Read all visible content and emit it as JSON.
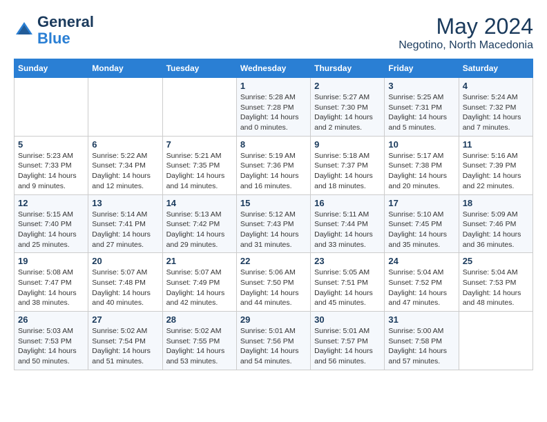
{
  "header": {
    "logo_line1": "General",
    "logo_line2": "Blue",
    "month": "May 2024",
    "location": "Negotino, North Macedonia"
  },
  "weekdays": [
    "Sunday",
    "Monday",
    "Tuesday",
    "Wednesday",
    "Thursday",
    "Friday",
    "Saturday"
  ],
  "weeks": [
    [
      {
        "day": "",
        "info": ""
      },
      {
        "day": "",
        "info": ""
      },
      {
        "day": "",
        "info": ""
      },
      {
        "day": "1",
        "info": "Sunrise: 5:28 AM\nSunset: 7:28 PM\nDaylight: 14 hours\nand 0 minutes."
      },
      {
        "day": "2",
        "info": "Sunrise: 5:27 AM\nSunset: 7:30 PM\nDaylight: 14 hours\nand 2 minutes."
      },
      {
        "day": "3",
        "info": "Sunrise: 5:25 AM\nSunset: 7:31 PM\nDaylight: 14 hours\nand 5 minutes."
      },
      {
        "day": "4",
        "info": "Sunrise: 5:24 AM\nSunset: 7:32 PM\nDaylight: 14 hours\nand 7 minutes."
      }
    ],
    [
      {
        "day": "5",
        "info": "Sunrise: 5:23 AM\nSunset: 7:33 PM\nDaylight: 14 hours\nand 9 minutes."
      },
      {
        "day": "6",
        "info": "Sunrise: 5:22 AM\nSunset: 7:34 PM\nDaylight: 14 hours\nand 12 minutes."
      },
      {
        "day": "7",
        "info": "Sunrise: 5:21 AM\nSunset: 7:35 PM\nDaylight: 14 hours\nand 14 minutes."
      },
      {
        "day": "8",
        "info": "Sunrise: 5:19 AM\nSunset: 7:36 PM\nDaylight: 14 hours\nand 16 minutes."
      },
      {
        "day": "9",
        "info": "Sunrise: 5:18 AM\nSunset: 7:37 PM\nDaylight: 14 hours\nand 18 minutes."
      },
      {
        "day": "10",
        "info": "Sunrise: 5:17 AM\nSunset: 7:38 PM\nDaylight: 14 hours\nand 20 minutes."
      },
      {
        "day": "11",
        "info": "Sunrise: 5:16 AM\nSunset: 7:39 PM\nDaylight: 14 hours\nand 22 minutes."
      }
    ],
    [
      {
        "day": "12",
        "info": "Sunrise: 5:15 AM\nSunset: 7:40 PM\nDaylight: 14 hours\nand 25 minutes."
      },
      {
        "day": "13",
        "info": "Sunrise: 5:14 AM\nSunset: 7:41 PM\nDaylight: 14 hours\nand 27 minutes."
      },
      {
        "day": "14",
        "info": "Sunrise: 5:13 AM\nSunset: 7:42 PM\nDaylight: 14 hours\nand 29 minutes."
      },
      {
        "day": "15",
        "info": "Sunrise: 5:12 AM\nSunset: 7:43 PM\nDaylight: 14 hours\nand 31 minutes."
      },
      {
        "day": "16",
        "info": "Sunrise: 5:11 AM\nSunset: 7:44 PM\nDaylight: 14 hours\nand 33 minutes."
      },
      {
        "day": "17",
        "info": "Sunrise: 5:10 AM\nSunset: 7:45 PM\nDaylight: 14 hours\nand 35 minutes."
      },
      {
        "day": "18",
        "info": "Sunrise: 5:09 AM\nSunset: 7:46 PM\nDaylight: 14 hours\nand 36 minutes."
      }
    ],
    [
      {
        "day": "19",
        "info": "Sunrise: 5:08 AM\nSunset: 7:47 PM\nDaylight: 14 hours\nand 38 minutes."
      },
      {
        "day": "20",
        "info": "Sunrise: 5:07 AM\nSunset: 7:48 PM\nDaylight: 14 hours\nand 40 minutes."
      },
      {
        "day": "21",
        "info": "Sunrise: 5:07 AM\nSunset: 7:49 PM\nDaylight: 14 hours\nand 42 minutes."
      },
      {
        "day": "22",
        "info": "Sunrise: 5:06 AM\nSunset: 7:50 PM\nDaylight: 14 hours\nand 44 minutes."
      },
      {
        "day": "23",
        "info": "Sunrise: 5:05 AM\nSunset: 7:51 PM\nDaylight: 14 hours\nand 45 minutes."
      },
      {
        "day": "24",
        "info": "Sunrise: 5:04 AM\nSunset: 7:52 PM\nDaylight: 14 hours\nand 47 minutes."
      },
      {
        "day": "25",
        "info": "Sunrise: 5:04 AM\nSunset: 7:53 PM\nDaylight: 14 hours\nand 48 minutes."
      }
    ],
    [
      {
        "day": "26",
        "info": "Sunrise: 5:03 AM\nSunset: 7:53 PM\nDaylight: 14 hours\nand 50 minutes."
      },
      {
        "day": "27",
        "info": "Sunrise: 5:02 AM\nSunset: 7:54 PM\nDaylight: 14 hours\nand 51 minutes."
      },
      {
        "day": "28",
        "info": "Sunrise: 5:02 AM\nSunset: 7:55 PM\nDaylight: 14 hours\nand 53 minutes."
      },
      {
        "day": "29",
        "info": "Sunrise: 5:01 AM\nSunset: 7:56 PM\nDaylight: 14 hours\nand 54 minutes."
      },
      {
        "day": "30",
        "info": "Sunrise: 5:01 AM\nSunset: 7:57 PM\nDaylight: 14 hours\nand 56 minutes."
      },
      {
        "day": "31",
        "info": "Sunrise: 5:00 AM\nSunset: 7:58 PM\nDaylight: 14 hours\nand 57 minutes."
      },
      {
        "day": "",
        "info": ""
      }
    ]
  ]
}
